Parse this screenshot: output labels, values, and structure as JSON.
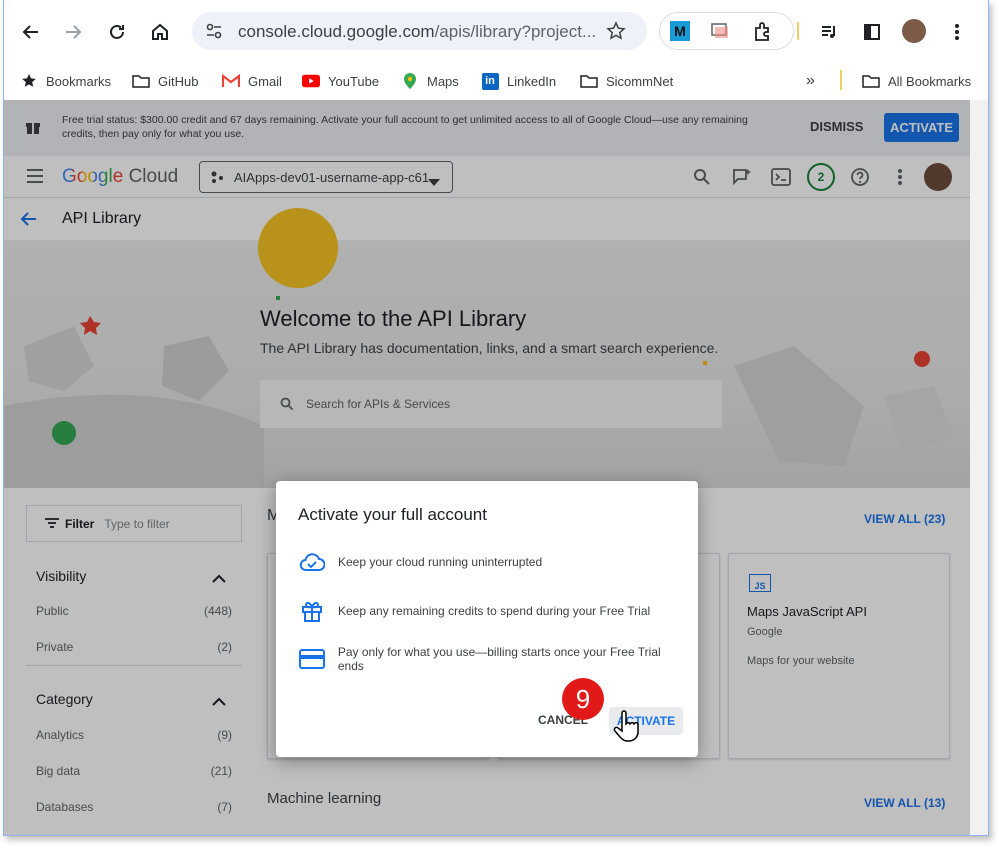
{
  "browser": {
    "url_main": "console.cloud.google.com",
    "url_rest": "/apis/library?project...",
    "bookmarks": [
      "Bookmarks",
      "GitHub",
      "Gmail",
      "YouTube",
      "Maps",
      "LinkedIn",
      "SicommNet"
    ],
    "all_bookmarks": "All Bookmarks"
  },
  "trial": {
    "text": "Free trial status: $300.00 credit and 67 days remaining. Activate your full account to get unlimited access to all of Google Cloud—use any remaining credits, then pay only for what you use.",
    "dismiss": "DISMISS",
    "activate": "ACTIVATE"
  },
  "header": {
    "logo_google": "Google",
    "logo_cloud": "Cloud",
    "project": "AIApps-dev01-username-app-c61",
    "notification_count": "2"
  },
  "page": {
    "title": "API Library",
    "hero_title": "Welcome to the API Library",
    "hero_subtitle": "The API Library has documentation, links, and a smart search experience.",
    "search_placeholder": "Search for APIs & Services"
  },
  "sidebar": {
    "filter_label": "Filter",
    "filter_placeholder": "Type to filter",
    "visibility_title": "Visibility",
    "visibility": [
      {
        "label": "Public",
        "count": "(448)"
      },
      {
        "label": "Private",
        "count": "(2)"
      }
    ],
    "category_title": "Category",
    "categories": [
      {
        "label": "Analytics",
        "count": "(9)"
      },
      {
        "label": "Big data",
        "count": "(21)"
      },
      {
        "label": "Databases",
        "count": "(7)"
      }
    ]
  },
  "content": {
    "section1_initial": "M",
    "view_all_1": "VIEW ALL (23)",
    "card_title": "Maps JavaScript API",
    "card_vendor": "Google",
    "card_desc": "Maps for your website",
    "section2_title": "Machine learning",
    "view_all_2": "VIEW ALL (13)"
  },
  "dialog": {
    "title": "Activate your full account",
    "items": [
      "Keep your cloud running uninterrupted",
      "Keep any remaining credits to spend during your Free Trial",
      "Pay only for what you use—billing starts once your Free Trial ends"
    ],
    "cancel": "CANCEL",
    "activate": "ACTIVATE"
  },
  "annotation": {
    "step": "9"
  },
  "colors": {
    "primary": "#1a73e8",
    "badge": "#e21919"
  }
}
